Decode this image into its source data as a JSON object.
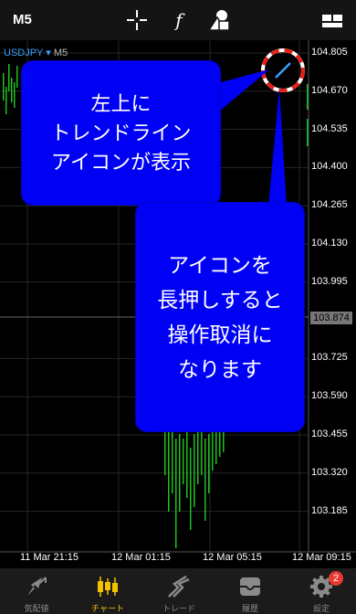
{
  "toolbar": {
    "timeframe": "M5",
    "icons": [
      "crosshair-icon",
      "function-icon",
      "objects-icon",
      "windows-icon"
    ]
  },
  "chart": {
    "symbol": "USDJPY",
    "symbol_arrow": "▾",
    "timeframe": "M5",
    "price_ticks": [
      "104.805",
      "104.670",
      "104.535",
      "104.400",
      "104.265",
      "104.130",
      "103.995",
      "103.874",
      "103.725",
      "103.590",
      "103.455",
      "103.320",
      "103.185"
    ],
    "current_price": "103.874",
    "time_ticks": [
      "11 Mar 21:15",
      "12 Mar 01:15",
      "12 Mar 05:15",
      "12 Mar 09:15"
    ],
    "candle_color": "#1fbf1f",
    "grid_color": "#262626",
    "trendline_icon": "trendline-icon"
  },
  "callouts": {
    "top": [
      "左上に",
      "トレンドライン",
      "アイコンが表示"
    ],
    "bottom": [
      "アイコンを",
      "長押しすると",
      "操作取消に",
      "なります"
    ],
    "color": "#0000f5"
  },
  "nav": [
    {
      "label": "気配値",
      "icon": "quotes-icon",
      "active": false
    },
    {
      "label": "チャート",
      "icon": "chart-icon",
      "active": true
    },
    {
      "label": "トレード",
      "icon": "trade-icon",
      "active": false
    },
    {
      "label": "履歴",
      "icon": "history-icon",
      "active": false
    },
    {
      "label": "設定",
      "icon": "settings-icon",
      "active": false,
      "badge": "2"
    }
  ]
}
